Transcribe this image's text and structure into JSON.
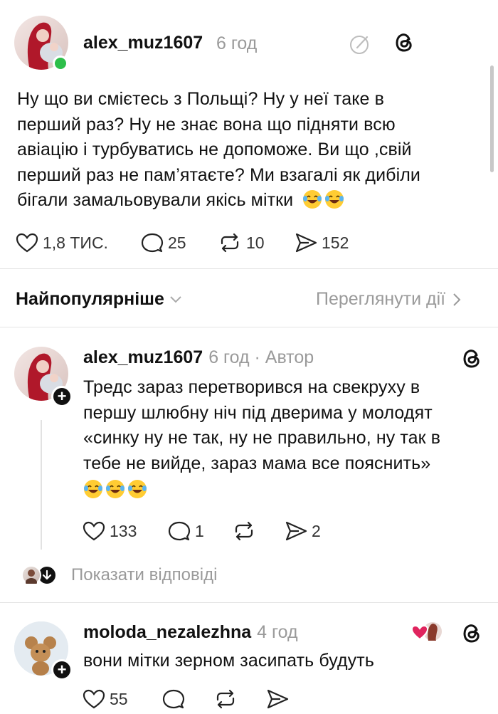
{
  "post": {
    "username": "alex_muz1607",
    "time": "6 год",
    "text_lines": [
      "Ну що ви смієтесь з Польщі? Ну у неї таке в",
      "перший раз?  Ну не знає вона що підняти всю",
      "авіацію і турбуватись не допоможе. Ви що ,свій",
      "перший раз не пам’ятаєте? Ми взагалі як дибіли",
      "бігали замальовували якісь мітки"
    ],
    "likes": "1,8 ТИС.",
    "comments": "25",
    "reposts": "10",
    "shares": "152",
    "icons": [
      "edit-circle-icon",
      "threads-icon",
      "heart-icon",
      "comment-icon",
      "repost-icon",
      "share-icon"
    ]
  },
  "sort_bar": {
    "label": "Найпопулярніше",
    "activity_link": "Переглянути дії"
  },
  "reply1": {
    "username": "alex_muz1607",
    "meta": "6 год · Автор",
    "text_lines": [
      "Тредс зараз перетворився на свекруху в",
      "першу шлюбну ніч  під дверима у молодят",
      "«синку ну не так, ну не правильно, ну так в",
      "тебе не вийде, зараз мама все пояснить»"
    ],
    "likes": "133",
    "comments": "1",
    "shares": "2",
    "show_replies": "Показати відповіді"
  },
  "reply2": {
    "username": "moloda_nezalezhna",
    "time": "4 год",
    "text": "вони мітки зерном засипать будуть",
    "likes": "55"
  },
  "colors": {
    "text": "#111111",
    "muted": "#9a9a9a",
    "online": "#2dbf4a",
    "heart_red": "#e0245e",
    "divider": "#e3e3e3"
  }
}
